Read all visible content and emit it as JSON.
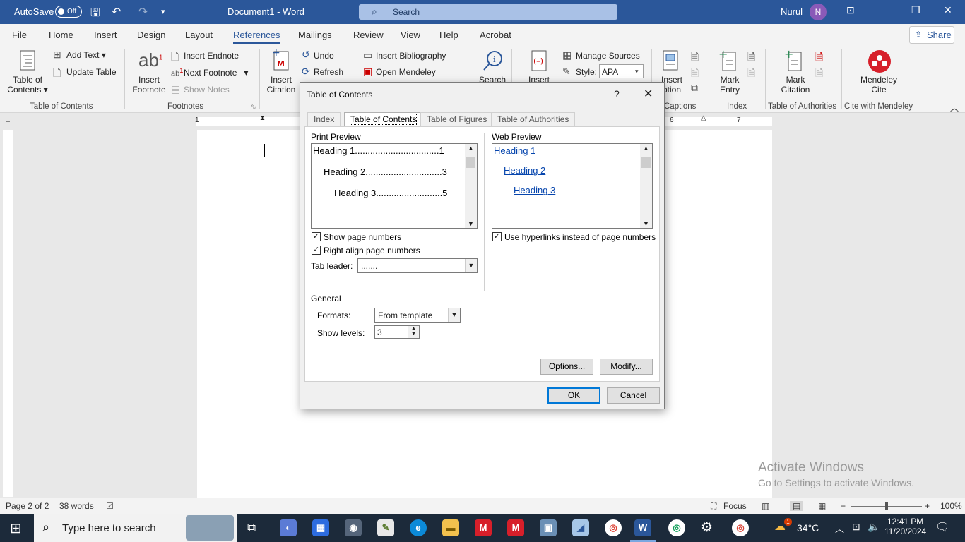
{
  "titlebar": {
    "autosave_label": "AutoSave",
    "autosave_state": "Off",
    "doc_title": "Document1  -  Word",
    "search_placeholder": "Search",
    "user_name": "Nurul",
    "user_initial": "N"
  },
  "menu": {
    "tabs": [
      "File",
      "Home",
      "Insert",
      "Design",
      "Layout",
      "References",
      "Mailings",
      "Review",
      "View",
      "Help",
      "Acrobat"
    ],
    "active": "References",
    "share": "Share"
  },
  "ribbon": {
    "toc_line1": "Table of",
    "toc_line2": "Contents",
    "add_text": "Add Text",
    "update_table": "Update Table",
    "group_toc": "Table of Contents",
    "insert_footnote_1": "Insert",
    "insert_footnote_2": "Footnote",
    "insert_endnote": "Insert Endnote",
    "next_footnote": "Next Footnote",
    "show_notes": "Show Notes",
    "group_footnotes": "Footnotes",
    "insert_citation_1": "Insert",
    "insert_citation_2": "Citation",
    "undo": "Undo",
    "refresh": "Refresh",
    "insert_bibliography": "Insert Bibliography",
    "open_mendeley": "Open Mendeley",
    "search": "Search",
    "insert_2": "Insert",
    "manage_sources": "Manage Sources",
    "style_label": "Style:",
    "style_value": "APA",
    "insert_caption_1": "Insert",
    "insert_caption_2": "ption",
    "group_captions": "Captions",
    "mark_entry_1": "Mark",
    "mark_entry_2": "Entry",
    "group_index": "Index",
    "mark_citation_1": "Mark",
    "mark_citation_2": "Citation",
    "group_toa": "Table of Authorities",
    "mendeley_cite_1": "Mendeley",
    "mendeley_cite_2": "Cite",
    "group_mendeley": "Cite with Mendeley"
  },
  "dialog": {
    "title": "Table of Contents",
    "help": "?",
    "tabs": [
      "Index",
      "Table of Contents",
      "Table of Figures",
      "Table of Authorities"
    ],
    "active_tab": "Table of Contents",
    "print_preview_label": "Print Preview",
    "web_preview_label": "Web Preview",
    "print_lines": [
      "Heading 1.................................1",
      "Heading 2..............................3",
      "Heading 3..........................5"
    ],
    "web_links": [
      "Heading 1",
      "Heading 2",
      "Heading 3"
    ],
    "show_page_numbers": "Show page numbers",
    "right_align": "Right align page numbers",
    "use_hyperlinks": "Use hyperlinks instead of page numbers",
    "tab_leader_label": "Tab leader:",
    "tab_leader_value": ".......",
    "general_label": "General",
    "formats_label": "Formats:",
    "formats_value": "From template",
    "show_levels_label": "Show levels:",
    "show_levels_value": "3",
    "options_btn": "Options...",
    "modify_btn": "Modify...",
    "ok_btn": "OK",
    "cancel_btn": "Cancel",
    "show_page_numbers_checked": true,
    "right_align_checked": true,
    "use_hyperlinks_checked": true
  },
  "watermark": {
    "line1": "Activate Windows",
    "line2": "Go to Settings to activate Windows."
  },
  "statusbar": {
    "page": "Page 2 of 2",
    "words": "38 words",
    "focus": "Focus",
    "zoom": "100%"
  },
  "taskbar": {
    "search_placeholder": "Type here to search",
    "temperature": "34°C",
    "time": "12:41 PM",
    "date": "11/20/2024",
    "weather_badge": "1"
  },
  "colors": {
    "word_blue": "#2b579a",
    "link_blue": "#0645ad",
    "default_button_border": "#0078d7"
  }
}
